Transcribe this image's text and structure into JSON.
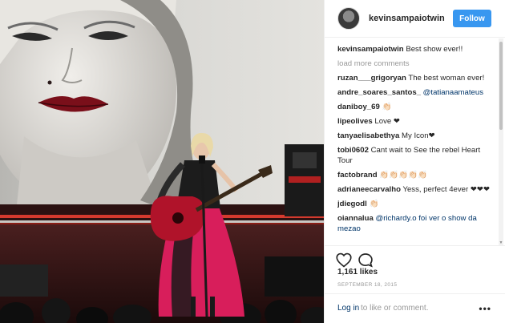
{
  "post": {
    "username": "kevinsampaiotwin",
    "follow_label": "Follow",
    "caption": "Best show ever!!",
    "load_more": "load more comments",
    "comments": [
      {
        "user": "ruzan___grigoryan",
        "text": "The best woman ever!",
        "mention": false
      },
      {
        "user": "andre_soares_santos_",
        "text": "@tatianaamateus",
        "mention": true
      },
      {
        "user": "daniboy_69",
        "text": "👏🏻",
        "mention": false
      },
      {
        "user": "lipeolives",
        "text": "Love ❤",
        "mention": false
      },
      {
        "user": "tanyaelisabethya",
        "text": "My Icon❤",
        "mention": false
      },
      {
        "user": "tobi0602",
        "text": "Cant wait to See the rebel Heart Tour",
        "mention": false
      },
      {
        "user": "factobrand",
        "text": "👏🏻👏🏻👏🏻👏🏻👏🏻",
        "mention": false
      },
      {
        "user": "adrianeecarvalho",
        "text": "Yess, perfect 4ever ❤❤❤",
        "mention": false
      },
      {
        "user": "jdiegodl",
        "text": "👏🏻",
        "mention": false
      },
      {
        "user": "oiannalua",
        "text": "@richardy.o foi ver o show da mezao",
        "mention": true
      }
    ],
    "likes": "1,161 likes",
    "date": "SEPTEMBER 18, 2015",
    "login_link": "Log in",
    "login_rest": "to like or comment.",
    "more_icon": "•••"
  },
  "icons": {
    "like": "heart-icon",
    "comment": "speech-bubble-icon",
    "more": "more-options-icon"
  },
  "colors": {
    "follow_button": "#3897f0",
    "link": "#003569",
    "muted": "#999999",
    "dress_red": "#d81e5b",
    "guitar_red": "#b0132a"
  }
}
